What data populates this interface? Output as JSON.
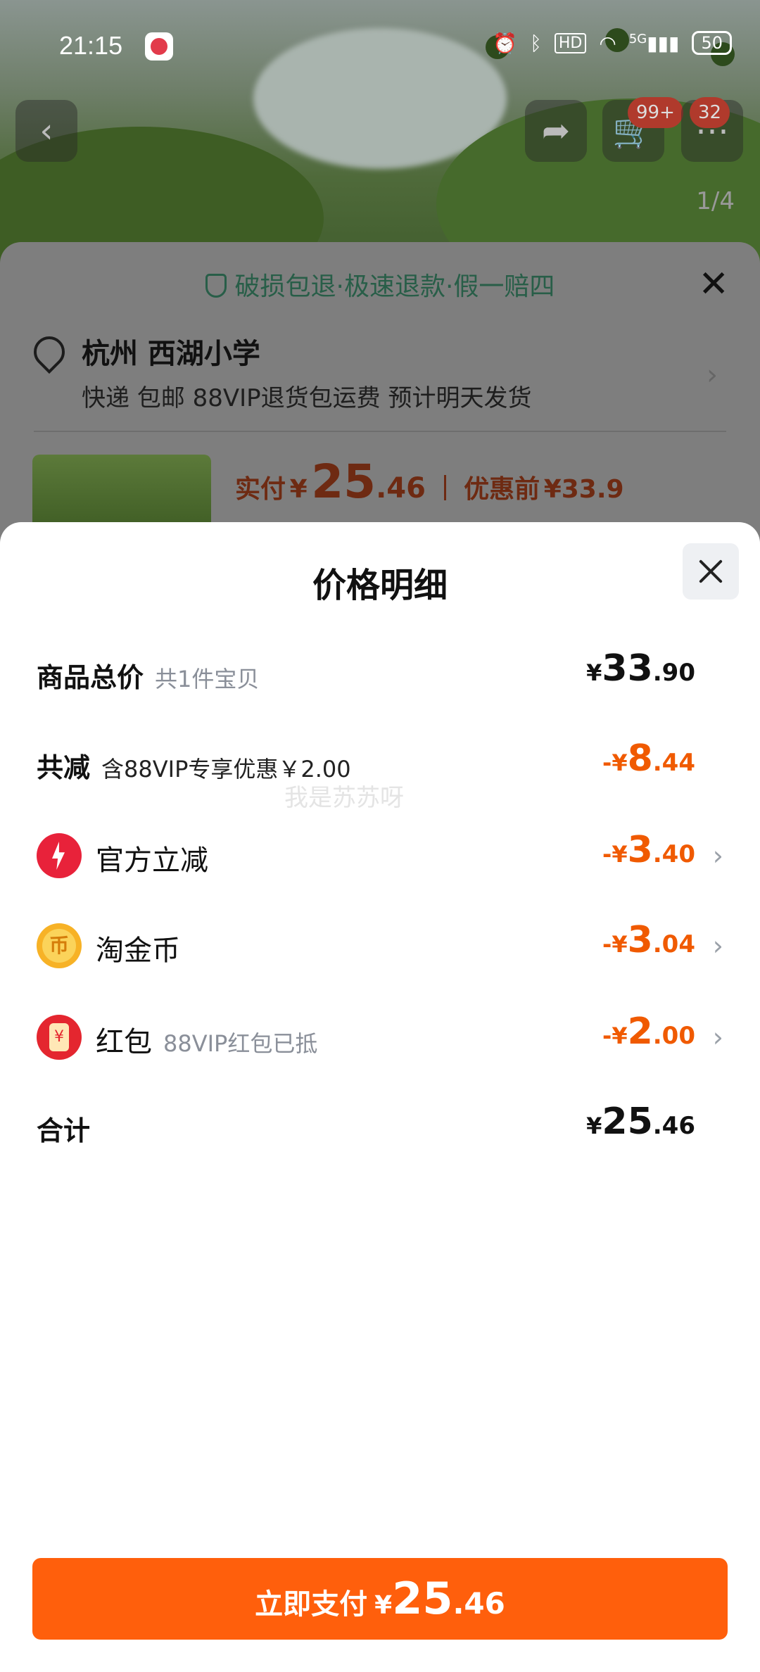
{
  "status_bar": {
    "time": "21:15",
    "network": "5G",
    "battery": "50"
  },
  "top_nav": {
    "cart_badge": "99+",
    "message_badge": "32",
    "image_pager": "1/4"
  },
  "order_sheet": {
    "guarantee": "破损包退·极速退款·假一赔四",
    "address": "杭州 西湖小学",
    "shipping": "快递 包邮 88VIP退货包运费 预计明天发货",
    "pay_label": "实付",
    "pay_currency": "¥",
    "pay_int": "25",
    "pay_dec": ".46",
    "before_label": "优惠前",
    "before_value": "¥33.9"
  },
  "price_detail": {
    "title": "价格明细",
    "rows": [
      {
        "name": "商品总价",
        "sub": "共1件宝贝",
        "sign": "",
        "currency": "¥",
        "int": "33",
        "dec": ".90"
      },
      {
        "name": "共减",
        "sub": "含88VIP专享优惠￥2.00",
        "sign": "-",
        "currency": "¥",
        "int": "8",
        "dec": ".44"
      },
      {
        "name": "官方立减",
        "sub": "",
        "sign": "-",
        "currency": "¥",
        "int": "3",
        "dec": ".40",
        "icon": "lightning-icon"
      },
      {
        "name": "淘金币",
        "sub": "",
        "sign": "-",
        "currency": "¥",
        "int": "3",
        "dec": ".04",
        "icon": "gold-coin-icon"
      },
      {
        "name": "红包",
        "sub": "88VIP红包已抵",
        "sign": "-",
        "currency": "¥",
        "int": "2",
        "dec": ".00",
        "icon": "red-packet-icon"
      },
      {
        "name": "合计",
        "sub": "",
        "sign": "",
        "currency": "¥",
        "int": "25",
        "dec": ".46"
      }
    ],
    "watermark": "我是苏苏呀"
  },
  "pay_button": {
    "label": "立即支付",
    "currency": "¥",
    "int": "25",
    "dec": ".46"
  },
  "colors": {
    "accent": "#ff5f0c",
    "discount": "#f05a00",
    "guarantee": "#2a9d6e"
  }
}
